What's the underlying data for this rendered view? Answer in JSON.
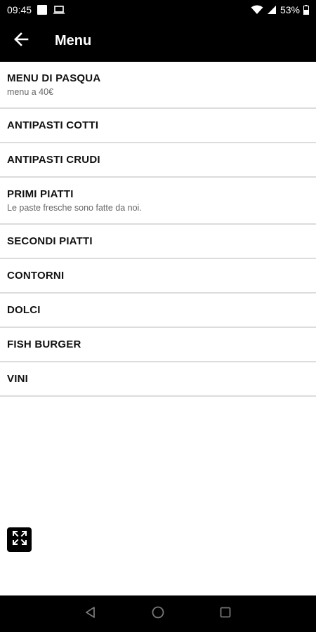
{
  "status_bar": {
    "time": "09:45",
    "battery": "53%",
    "icons": [
      "notification-square-icon",
      "laptop-icon",
      "wifi-icon",
      "signal-icon",
      "battery-icon"
    ]
  },
  "app_bar": {
    "title": "Menu",
    "back_icon": "arrow-left-icon"
  },
  "menu": {
    "items": [
      {
        "title": "MENU DI PASQUA",
        "subtitle": "menu a 40€"
      },
      {
        "title": "ANTIPASTI COTTI",
        "subtitle": ""
      },
      {
        "title": "ANTIPASTI CRUDI",
        "subtitle": ""
      },
      {
        "title": "PRIMI PIATTI",
        "subtitle": "Le paste fresche sono fatte da noi."
      },
      {
        "title": "SECONDI PIATTI",
        "subtitle": ""
      },
      {
        "title": "CONTORNI",
        "subtitle": ""
      },
      {
        "title": "DOLCI",
        "subtitle": ""
      },
      {
        "title": "FISH BURGER",
        "subtitle": ""
      },
      {
        "title": "VINI",
        "subtitle": ""
      }
    ]
  },
  "expand_button": {
    "icon": "expand-icon"
  },
  "nav_bar": {
    "icons": [
      "back-triangle-icon",
      "home-circle-icon",
      "recents-square-icon"
    ]
  },
  "colors": {
    "bar_background": "#000000",
    "divider": "#dcdcdc",
    "text": "#111111",
    "subtext": "#666666"
  }
}
